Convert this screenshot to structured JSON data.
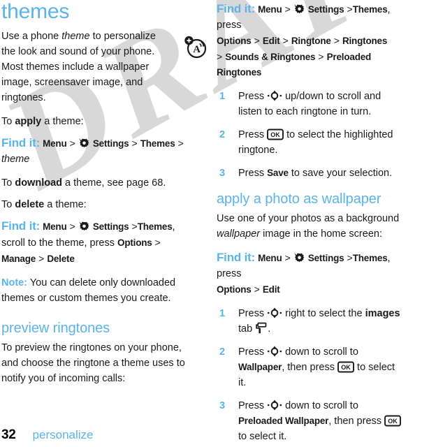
{
  "page": {
    "number": "32",
    "section": "personalize",
    "watermark": "DRAFT",
    "accent_color": "#5bb4e8",
    "text_color": "#1a1a1a"
  },
  "left": {
    "title": "themes",
    "intro_pre": "Use a phone ",
    "intro_em": "theme",
    "intro_post": " to personalize the look and sound of your phone. Most themes include a wallpaper image, screensaver image, and ringtones.",
    "apply_pre": "To ",
    "apply_em": "apply",
    "apply_post": " a theme:",
    "findit1": {
      "label": "Find it:",
      "menu": "Menu",
      "sep": ">",
      "settings": "Settings",
      "themes": "Themes",
      "theme_italic": "theme"
    },
    "download_pre": "To ",
    "download_em": "download",
    "download_post": " a theme, see page 68.",
    "delete_pre": "To ",
    "delete_em": "delete",
    "delete_post": " a theme:",
    "findit2": {
      "label": "Find it:",
      "menu": "Menu",
      "sep": ">",
      "settings": "Settings",
      "themes": "Themes",
      "mid": ", scroll to the theme, press ",
      "options": "Options",
      "manage": "Manage",
      "delete": "Delete"
    },
    "note_label": "Note:",
    "note_text": " You can delete only downloaded themes or custom themes you create.",
    "preview_title": "preview ringtones",
    "preview_body": "To preview the ringtones on your phone, and choose the ringtone a theme uses to notify you of incoming calls:"
  },
  "right": {
    "findit3": {
      "label": "Find it:",
      "menu": "Menu",
      "sep": ">",
      "settings": "Settings",
      "themes": "Themes",
      "press": ", press",
      "options": "Options",
      "edit": "Edit",
      "ringtone": "Ringtone",
      "ringtones": "Ringtones",
      "sounds": "Sounds & Ringtones",
      "preloaded": "Preloaded Ringtones"
    },
    "steps1": [
      {
        "num": "1",
        "pre": "Press ",
        "icon": "nav-key-icon",
        "mid": " up/down to scroll and listen to each ringtone in turn.",
        "bold": "",
        "post": ""
      },
      {
        "num": "2",
        "pre": "Press ",
        "icon": "ok-key-icon",
        "mid": " to select the highlighted ringtone.",
        "bold": "",
        "post": ""
      },
      {
        "num": "3",
        "pre": "Press ",
        "icon": "",
        "mid": "",
        "bold": "Save",
        "post": " to save your selection."
      }
    ],
    "wallpaper_title": "apply a photo as wallpaper",
    "wallpaper_pre": "Use one of your photos as a background ",
    "wallpaper_em": "wallpaper",
    "wallpaper_post": " image in the home screen:",
    "findit4": {
      "label": "Find it:",
      "menu": "Menu",
      "sep": ">",
      "settings": "Settings",
      "themes": "Themes",
      "press": ", press",
      "options": "Options",
      "edit": "Edit"
    },
    "steps2": [
      {
        "num": "1",
        "pre": "Press ",
        "mid": " right to select the ",
        "bold": "images",
        "post": " tab ",
        "tail": "."
      },
      {
        "num": "2",
        "pre": "Press ",
        "mid": " down to scroll to ",
        "bold": "Wallpaper",
        "post": ", then press ",
        "tail": " to select it."
      },
      {
        "num": "3",
        "pre": "Press ",
        "mid": " down to scroll to ",
        "bold": "Preloaded Wallpaper",
        "post": ", then press ",
        "tail": " to select it."
      }
    ]
  },
  "icons": {
    "theme_badge": "theme-audio-badge-icon",
    "settings": "settings-gear-icon",
    "nav_key": "nav-key-icon",
    "ok_key": "ok-key-icon",
    "images_tab": "paint-roller-icon"
  }
}
